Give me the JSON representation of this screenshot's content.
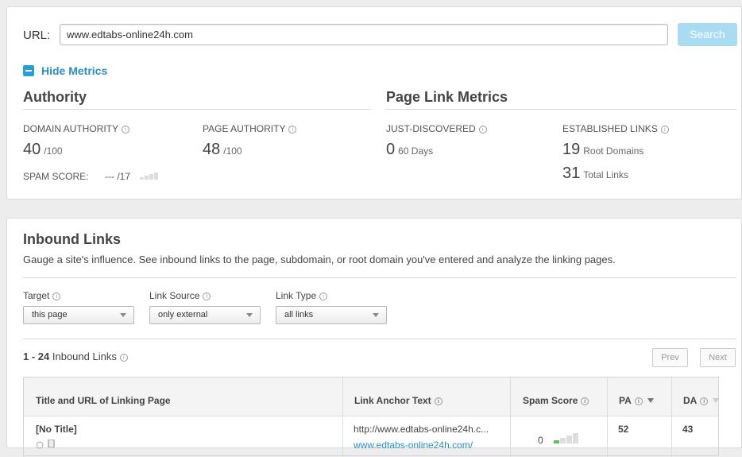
{
  "url_bar": {
    "label": "URL:",
    "value": "www.edtabs-online24h.com",
    "search_label": "Search"
  },
  "metrics_toggle": {
    "label": "Hide Metrics"
  },
  "authority": {
    "title": "Authority",
    "domain_authority": {
      "label": "DOMAIN AUTHORITY",
      "value": "40",
      "suffix": "/100"
    },
    "page_authority": {
      "label": "PAGE AUTHORITY",
      "value": "48",
      "suffix": "/100"
    },
    "spam_score": {
      "label": "SPAM SCORE:",
      "value": "--- /17"
    }
  },
  "page_link_metrics": {
    "title": "Page Link Metrics",
    "just_discovered": {
      "label": "JUST-DISCOVERED",
      "value": "0",
      "suffix": "60 Days"
    },
    "established_links": {
      "label": "ESTABLISHED LINKS",
      "root_domains": {
        "value": "19",
        "suffix": "Root Domains"
      },
      "total_links": {
        "value": "31",
        "suffix": "Total Links"
      }
    }
  },
  "inbound": {
    "title": "Inbound Links",
    "description": "Gauge a site's influence. See inbound links to the page, subdomain, or root domain you've entered and analyze the linking pages.",
    "filters": {
      "target": {
        "label": "Target",
        "value": "this page"
      },
      "link_source": {
        "label": "Link Source",
        "value": "only external"
      },
      "link_type": {
        "label": "Link Type",
        "value": "all links"
      }
    },
    "count": {
      "range": "1 - 24",
      "label": "Inbound Links"
    },
    "pager": {
      "prev": "Prev",
      "next": "Next"
    },
    "table": {
      "headers": {
        "title_url": "Title and URL of Linking Page",
        "anchor": "Link Anchor Text",
        "spam": "Spam Score",
        "pa": "PA",
        "da": "DA"
      },
      "rows": [
        {
          "title": "[No Title]",
          "url": "... ",
          "anchor": "http://www.edtabs-online24h.c...",
          "anchor_url": "www.edtabs-online24h.com/",
          "spam": "0",
          "pa": "52",
          "da": "43"
        }
      ]
    }
  },
  "colors": {
    "accent": "#2a9fd6",
    "search_button": "#a9dcf2",
    "spam_green": "#5cbf5c"
  }
}
